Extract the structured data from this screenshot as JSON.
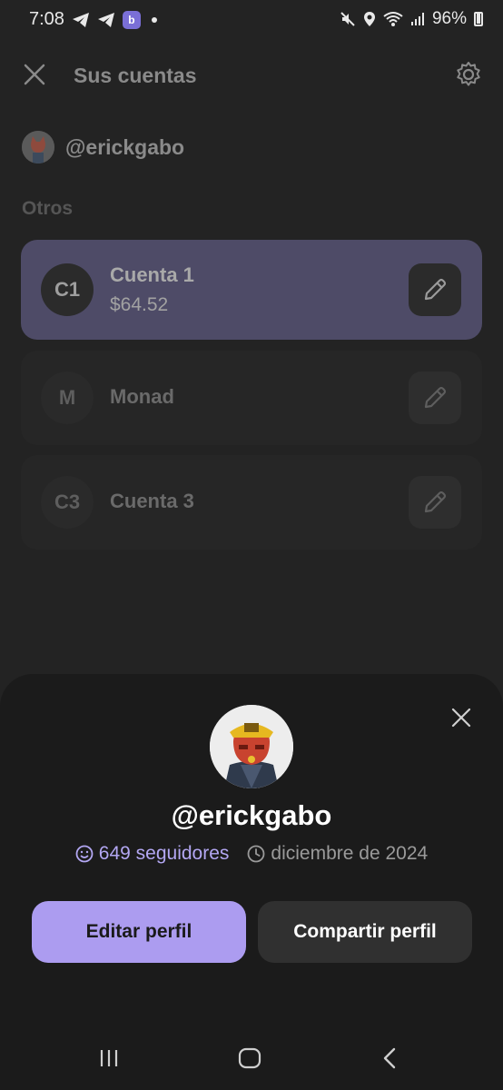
{
  "status": {
    "time": "7:08",
    "battery": "96%"
  },
  "header": {
    "title": "Sus cuentas"
  },
  "user": {
    "handle": "@erickgabo"
  },
  "section_label": "Otros",
  "accounts": [
    {
      "initials": "C1",
      "name": "Cuenta 1",
      "balance": "$64.52",
      "active": true
    },
    {
      "initials": "M",
      "name": "Monad",
      "active": false
    },
    {
      "initials": "C3",
      "name": "Cuenta 3",
      "active": false
    }
  ],
  "sheet": {
    "handle": "@erickgabo",
    "followers": "649 seguidores",
    "joined": "diciembre de 2024",
    "edit_button": "Editar perfil",
    "share_button": "Compartir perfil"
  },
  "colors": {
    "accent": "#ac9cf0",
    "active_card": "#4e4b67",
    "followers_text": "#b3a7f3"
  }
}
